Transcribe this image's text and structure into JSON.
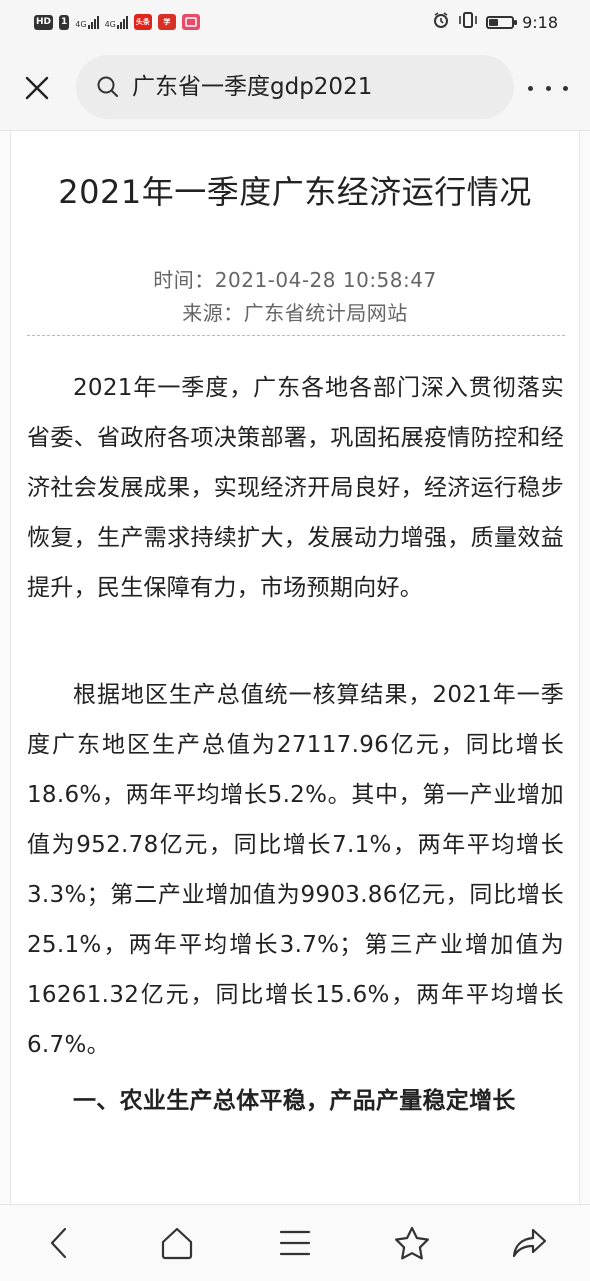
{
  "status_bar": {
    "left_badges": [
      "HD",
      "1"
    ],
    "network_labels": [
      "4G",
      "4G"
    ],
    "app_icons": [
      {
        "name": "toutiao-app-icon",
        "label": "头条"
      },
      {
        "name": "news-app-icon",
        "label": "学"
      },
      {
        "name": "app-icon",
        "label": ""
      }
    ],
    "time": "9:18"
  },
  "nav": {
    "search_query": "广东省一季度gdp2021"
  },
  "article": {
    "title": "2021年一季度广东经济运行情况",
    "time_line": "时间：2021-04-28 10:58:47",
    "source_line": "来源：广东省统计局网站",
    "paragraphs": [
      "2021年一季度，广东各地各部门深入贯彻落实省委、省政府各项决策部署，巩固拓展疫情防控和经济社会发展成果，实现经济开局良好，经济运行稳步恢复，生产需求持续扩大，发展动力增强，质量效益提升，民生保障有力，市场预期向好。",
      "根据地区生产总值统一核算结果，2021年一季度广东地区生产总值为27117.96亿元，同比增长18.6%，两年平均增长5.2%。其中，第一产业增加值为952.78亿元，同比增长7.1%，两年平均增长3.3%；第二产业增加值为9903.86亿元，同比增长25.1%，两年平均增长3.7%；第三产业增加值为16261.32亿元，同比增长15.6%，两年平均增长6.7%。"
    ],
    "section_heading": "一、农业生产总体平稳，产品产量稳定增长"
  },
  "toolbar": {
    "icons": [
      "back-icon",
      "home-icon",
      "menu-icon",
      "favorite-star-icon",
      "share-icon"
    ]
  },
  "colors": {
    "background": "#fafafa",
    "text": "#222222",
    "meta_text": "#666666",
    "search_bg": "#ececec"
  }
}
